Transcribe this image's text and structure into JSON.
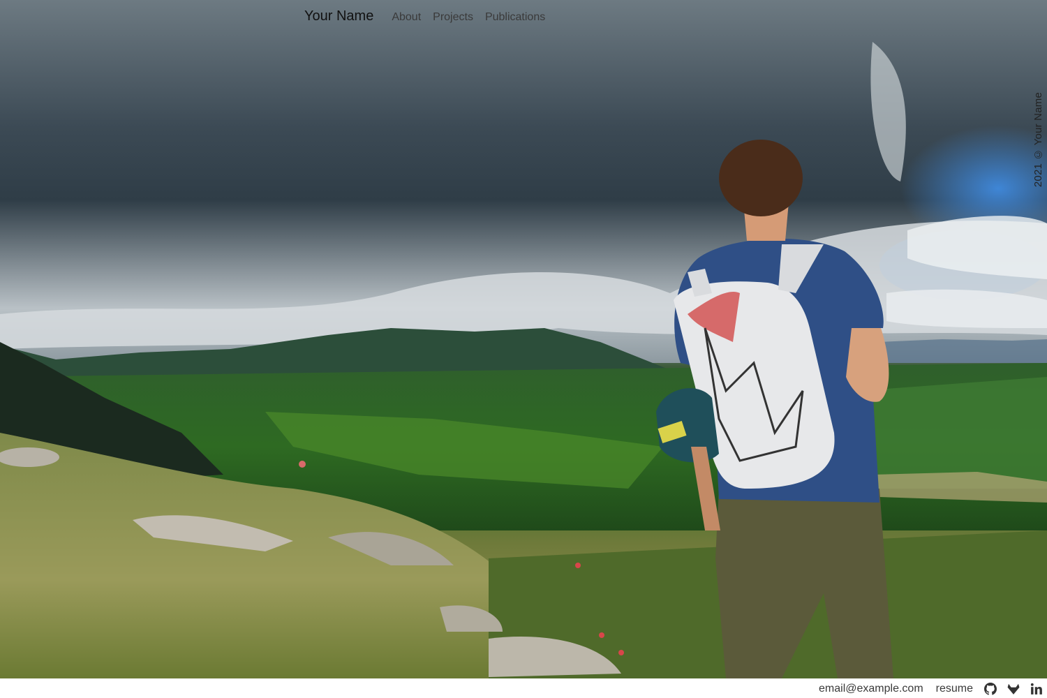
{
  "nav": {
    "brand": "Your Name",
    "links": [
      "About",
      "Projects",
      "Publications"
    ]
  },
  "hero": {
    "image_description_icon": "landscape-photo"
  },
  "side": {
    "copyright": "2021 © Your Name"
  },
  "footer": {
    "email": "email@example.com",
    "resume": "resume",
    "icons": [
      "github-icon",
      "gitlab-icon",
      "linkedin-icon"
    ]
  },
  "colors": {
    "text": "#3a3a3a",
    "brand": "#111111",
    "background": "#ffffff"
  }
}
